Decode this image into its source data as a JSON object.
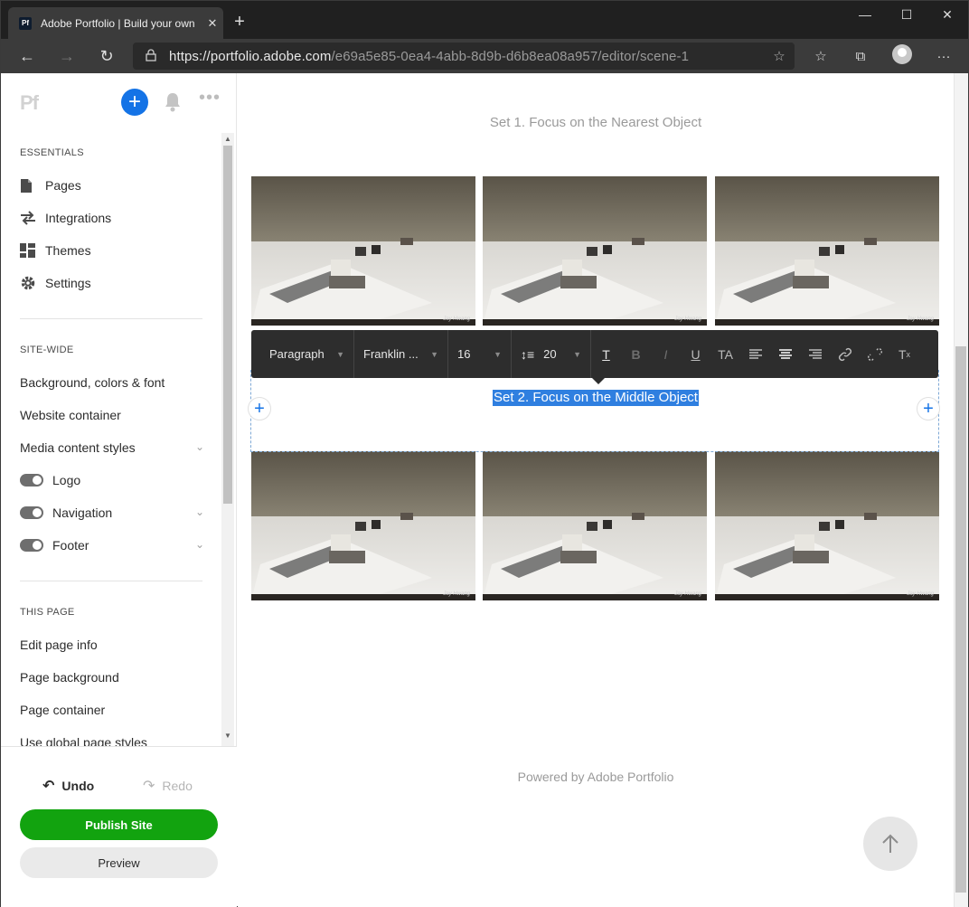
{
  "browser": {
    "tab_title": "Adobe Portfolio | Build your own",
    "tab_favicon": "Pf",
    "url_host": "https://portfolio.adobe.com",
    "url_path": "/e69a5e85-0ea4-4abb-8d9b-d6b8ea08a957/editor/scene-1"
  },
  "sidebar": {
    "logo": "Pf",
    "essentials_heading": "ESSENTIALS",
    "essentials": [
      {
        "label": "Pages",
        "icon": "file-icon"
      },
      {
        "label": "Integrations",
        "icon": "swap-icon"
      },
      {
        "label": "Themes",
        "icon": "layout-icon"
      },
      {
        "label": "Settings",
        "icon": "gear-icon"
      }
    ],
    "sitewide_heading": "SITE-WIDE",
    "sitewide": [
      {
        "label": "Background, colors & font"
      },
      {
        "label": "Website container"
      },
      {
        "label": "Media content styles"
      },
      {
        "label": "Logo"
      },
      {
        "label": "Navigation"
      },
      {
        "label": "Footer"
      }
    ],
    "thispage_heading": "THIS PAGE",
    "thispage": [
      {
        "label": "Edit page info"
      },
      {
        "label": "Page background"
      },
      {
        "label": "Page container"
      },
      {
        "label": "Use global page styles"
      }
    ],
    "undo": "Undo",
    "redo": "Redo",
    "publish": "Publish Site",
    "preview": "Preview"
  },
  "canvas": {
    "set1_title": "Set 1. Focus on the Nearest Object",
    "set2_title": "Set 2. Focus on the Middle Object",
    "photo_credit": "Jay Hwang",
    "footer": "Powered by Adobe Portfolio"
  },
  "toolbar": {
    "block_type": "Paragraph",
    "font": "Franklin ...",
    "font_size": "16",
    "line_height": "20",
    "text_color_glyph": "T",
    "bold": "B",
    "italic": "I",
    "underline": "U",
    "case": "TA",
    "clear": "T"
  },
  "colors": {
    "accent_blue": "#1473e6",
    "publish_green": "#12a30f",
    "selection_blue": "#2f7fe0"
  }
}
